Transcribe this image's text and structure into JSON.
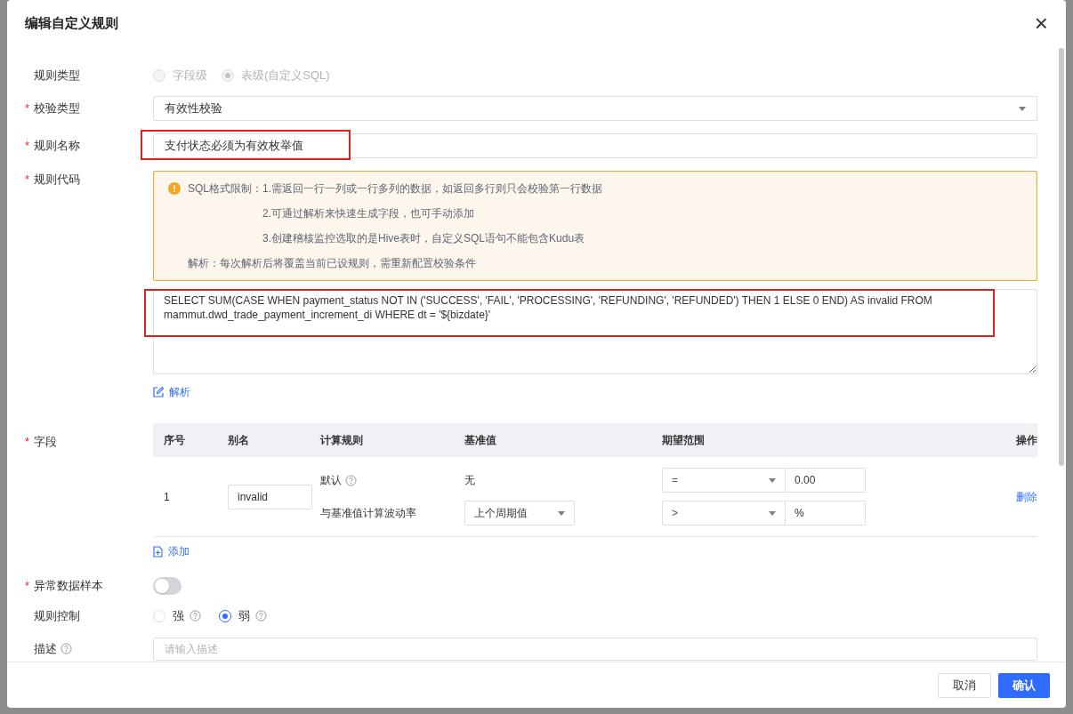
{
  "dialog": {
    "title": "编辑自定义规则",
    "close": "×"
  },
  "rule_type": {
    "label": "规则类型",
    "disabled": true,
    "options": [
      {
        "label": "字段级",
        "selected": false
      },
      {
        "label": "表级(自定义SQL)",
        "selected": true
      }
    ]
  },
  "check_type": {
    "label": "校验类型",
    "required_mark": "*",
    "value": "有效性校验"
  },
  "rule_name": {
    "label": "规则名称",
    "required_mark": "*",
    "value": "支付状态必须为有效枚举值",
    "highlighted": true
  },
  "rule_code": {
    "label": "规则代码",
    "required_mark": "*",
    "notice": {
      "icon": "!",
      "lines": [
        {
          "prefix": "SQL格式限制：",
          "text": "1.需返回一行一列或一行多列的数据，如返回多行则只会校验第一行数据"
        },
        {
          "text": "2.可通过解析来快速生成字段，也可手动添加"
        },
        {
          "text": "3.创建稽核监控选取的是Hive表时，自定义SQL语句不能包含Kudu表"
        }
      ],
      "footer": "解析：每次解析后将覆盖当前已设规则，需重新配置校验条件"
    },
    "sql": "SELECT SUM(CASE WHEN payment_status NOT IN ('SUCCESS', 'FAIL', 'PROCESSING', 'REFUNDING', 'REFUNDED') THEN 1 ELSE 0 END) AS invalid FROM mammut.dwd_trade_payment_increment_di WHERE dt = '${bizdate}'",
    "highlighted": true,
    "parse_link": "解析"
  },
  "fields": {
    "label": "字段",
    "required_mark": "*",
    "columns": [
      "序号",
      "别名",
      "计算规则",
      "基准值",
      "期望范围",
      "操作"
    ],
    "rows": [
      {
        "index": "1",
        "alias": "invalid",
        "action": "删除",
        "rules": [
          {
            "kind": "text",
            "name": "默认",
            "help": true,
            "baseline": "无",
            "operator": "=",
            "value": "0.00"
          },
          {
            "kind": "select",
            "name": "与基准值计算波动率",
            "baseline": "上个周期值",
            "operator": ">",
            "value": "%"
          }
        ]
      }
    ],
    "add_link": "添加"
  },
  "sample": {
    "label": "异常数据样本",
    "required_mark": "*",
    "on": false
  },
  "control": {
    "label": "规则控制",
    "options": [
      {
        "label": "强",
        "selected": false
      },
      {
        "label": "弱",
        "selected": true
      }
    ]
  },
  "description": {
    "label": "描述",
    "placeholder": "请输入描述"
  },
  "footer": {
    "buttons": [
      {
        "label": "取消",
        "kind": "secondary"
      },
      {
        "label": "确认",
        "kind": "primary"
      }
    ]
  }
}
